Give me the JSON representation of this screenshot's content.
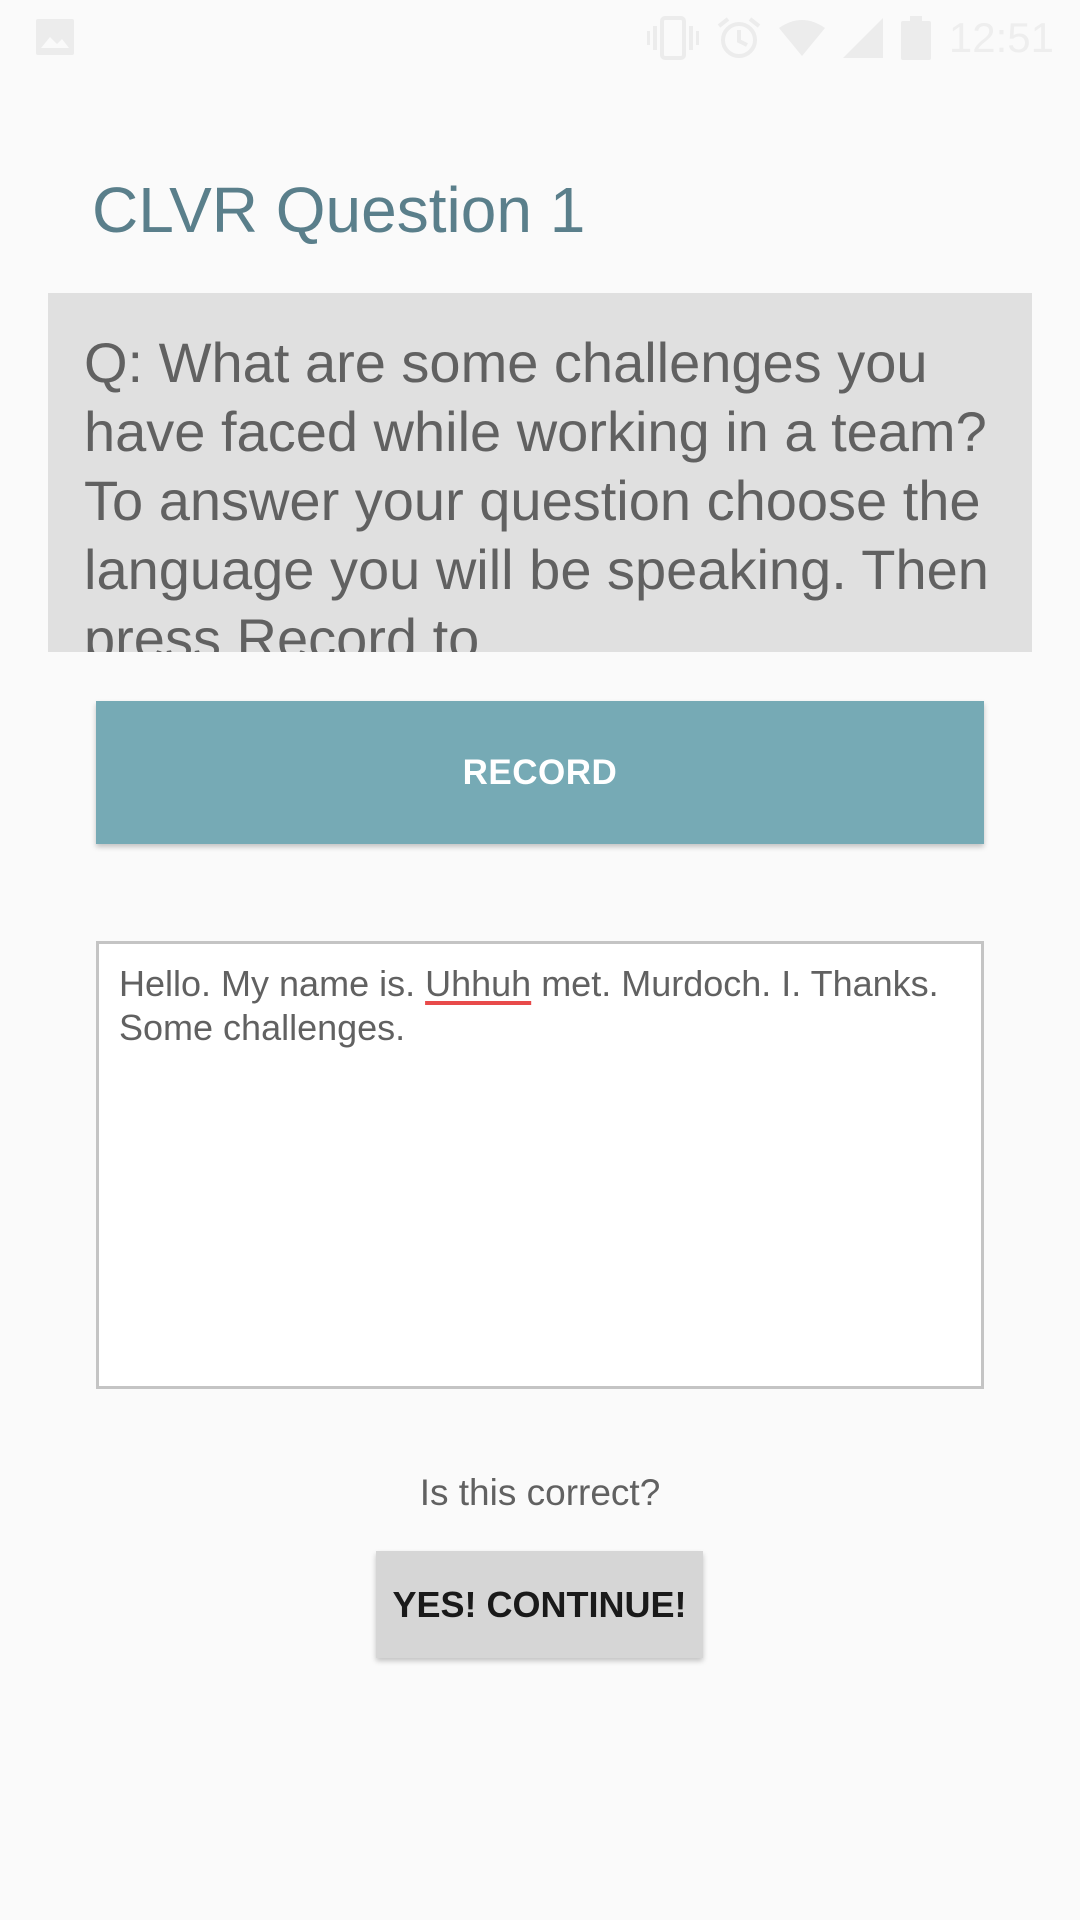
{
  "status_bar": {
    "time": "12:51",
    "icons": [
      "image-icon",
      "vibrate-icon",
      "alarm-icon",
      "wifi-icon",
      "signal-icon",
      "battery-icon"
    ]
  },
  "header": {
    "title": "CLVR Question 1"
  },
  "question": {
    "text": "Q: What are some challenges you have faced while working in a team? To answer your question choose the language you will be speaking. Then press Record to"
  },
  "record_button": {
    "label": "RECORD"
  },
  "transcript": {
    "before_error": "Hello. My name is. ",
    "misspelled_word": "Uhhuh",
    "after_error": " met. Murdoch. I. Thanks. Some challenges."
  },
  "confirm": {
    "prompt": "Is this correct?",
    "button_label": "YES! CONTINUE!"
  },
  "colors": {
    "title": "#5a7f8b",
    "record_button": "#76aab5",
    "spell_underline": "#e84a4a"
  }
}
